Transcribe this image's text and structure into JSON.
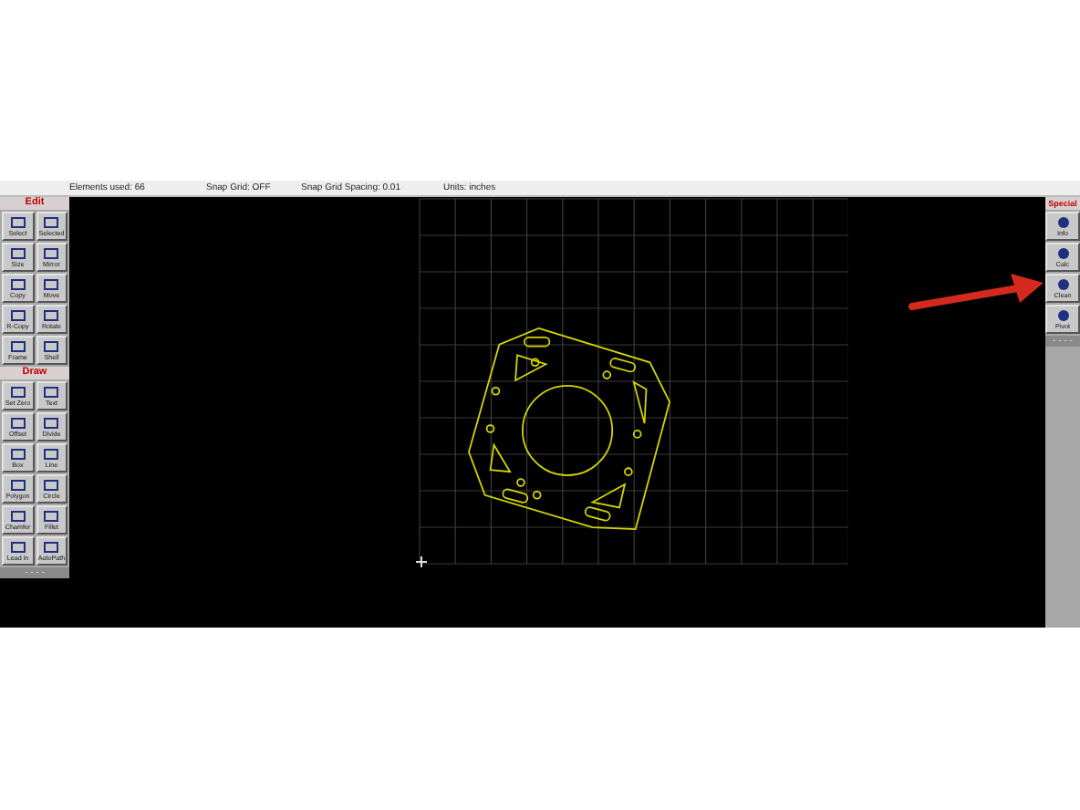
{
  "status_bar": {
    "elements": "Elements used: 66",
    "snap_grid": "Snap Grid: OFF",
    "snap_spacing": "Snap Grid Spacing: 0.01",
    "units": "Units: inches"
  },
  "left_toolbar": {
    "sections": [
      {
        "title": "Edit",
        "tools": [
          "Select",
          "Selected",
          "Size",
          "Mirror",
          "Copy",
          "Move",
          "R-Copy",
          "Rotate",
          "Frame",
          "Shell"
        ]
      },
      {
        "title": "Draw",
        "tools": [
          "Set Zero",
          "Text",
          "Offset",
          "Divide",
          "Box",
          "Line",
          "Polygon",
          "Circle",
          "Chamfer",
          "Fillet",
          "Lead in",
          "AutoPath"
        ]
      }
    ],
    "footer": "- - - -"
  },
  "right_toolbar": {
    "title": "Special",
    "tools": [
      "Info",
      "Calc",
      "Clean",
      "Pivot"
    ],
    "footer": "- - - -"
  }
}
